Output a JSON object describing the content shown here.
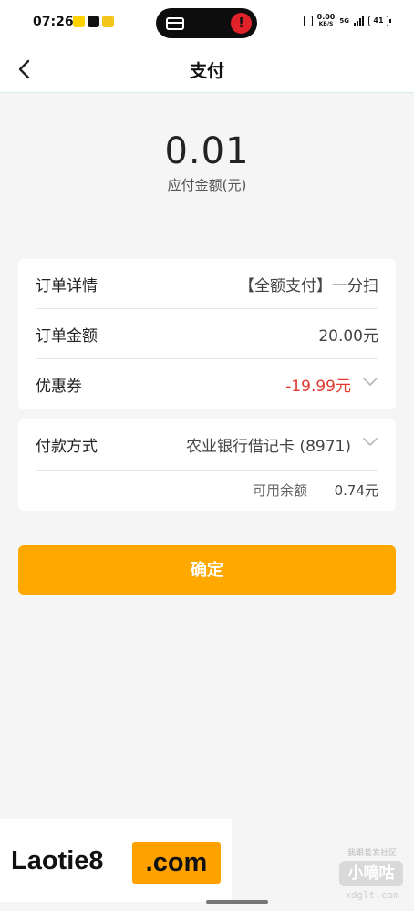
{
  "status_bar": {
    "time": "07:26",
    "net_speed": "0.00",
    "net_unit": "KB/S",
    "network": "5G",
    "battery": "41"
  },
  "nav": {
    "title": "支付"
  },
  "payment": {
    "amount": "0.01",
    "amount_label": "应付金额(元)"
  },
  "order": {
    "rows": [
      {
        "label": "订单详情",
        "value": "【全额支付】一分扫"
      },
      {
        "label": "订单金额",
        "value": "20.00元"
      },
      {
        "label": "优惠券",
        "value": "-19.99元"
      }
    ]
  },
  "pay_method": {
    "label": "付款方式",
    "value": "农业银行借记卡 (8971)",
    "balance_label": "可用余额",
    "balance_value": "0.74元"
  },
  "confirm_label": "确定",
  "colors": {
    "accent": "#ffa800",
    "discount_red": "#e23a30",
    "page_bg": "#f5f5f5"
  },
  "watermark": {
    "left_text": "Laotie8",
    "left_suffix": ".com",
    "right_top": "我跟着发社区",
    "right_name": "小嘀咕",
    "right_url": "xdglt.com"
  }
}
